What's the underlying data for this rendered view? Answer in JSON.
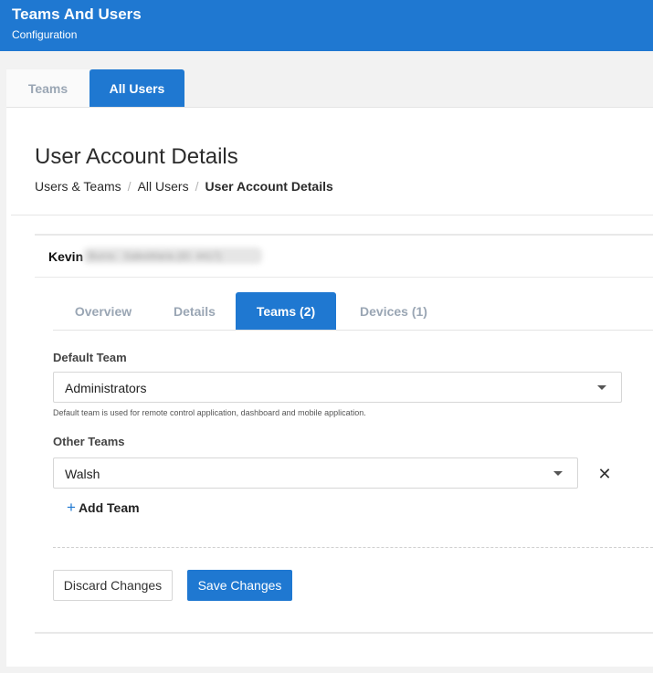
{
  "header": {
    "title": "Teams And Users",
    "subtitle": "Configuration",
    "background_color": "#1f78d1"
  },
  "top_tabs": {
    "items": [
      {
        "label": "Teams",
        "active": false
      },
      {
        "label": "All Users",
        "active": true
      }
    ]
  },
  "page": {
    "title": "User Account Details",
    "breadcrumb": [
      "Users & Teams",
      "All Users",
      "User Account Details"
    ],
    "breadcrumb_separator": "/"
  },
  "user": {
    "first_name": "Kevin",
    "redacted_remainder": "Burns · SalesMaria (ID: 4417)"
  },
  "sub_tabs": {
    "items": [
      {
        "label": "Overview",
        "active": false
      },
      {
        "label": "Details",
        "active": false
      },
      {
        "label": "Teams (2)",
        "active": true
      },
      {
        "label": "Devices (1)",
        "active": false
      }
    ]
  },
  "form": {
    "default_team_label": "Default Team",
    "default_team_value": "Administrators",
    "default_team_hint": "Default team is used for remote control application, dashboard and mobile application.",
    "other_teams_label": "Other Teams",
    "other_teams": [
      {
        "value": "Walsh",
        "remove_icon": "close-icon"
      }
    ],
    "add_team_label": "Add Team",
    "add_team_icon": "plus-icon"
  },
  "actions": {
    "discard_label": "Discard Changes",
    "save_label": "Save Changes"
  },
  "colors": {
    "accent": "#1f78d1",
    "inactive_tab_text": "#9aa6b4"
  }
}
